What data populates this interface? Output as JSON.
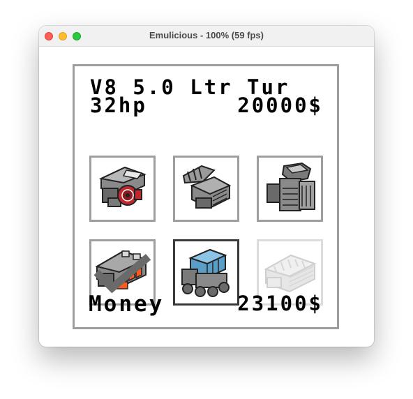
{
  "window": {
    "title": "Emulicious - 100% (59 fps)"
  },
  "engine": {
    "name": "V8 5.0 Ltr Tur",
    "power": "32hp",
    "price": "20000$"
  },
  "money": {
    "label": "Money",
    "value": "23100$"
  },
  "slots": [
    {
      "icon": "engine-red-turbo-icon",
      "state": "normal"
    },
    {
      "icon": "engine-gray-block-icon",
      "state": "normal"
    },
    {
      "icon": "engine-tall-gray-icon",
      "state": "normal"
    },
    {
      "icon": "engine-orange-intake-icon",
      "state": "owned"
    },
    {
      "icon": "engine-v8-blue-icon",
      "state": "selected"
    },
    {
      "icon": "engine-locked-icon",
      "state": "locked"
    }
  ],
  "colors": {
    "frame": "#9e9e9e",
    "selected_frame": "#3a3a3a",
    "accent_red": "#c0282d",
    "accent_orange": "#ff5a1e",
    "accent_blue": "#5a9ec8"
  }
}
